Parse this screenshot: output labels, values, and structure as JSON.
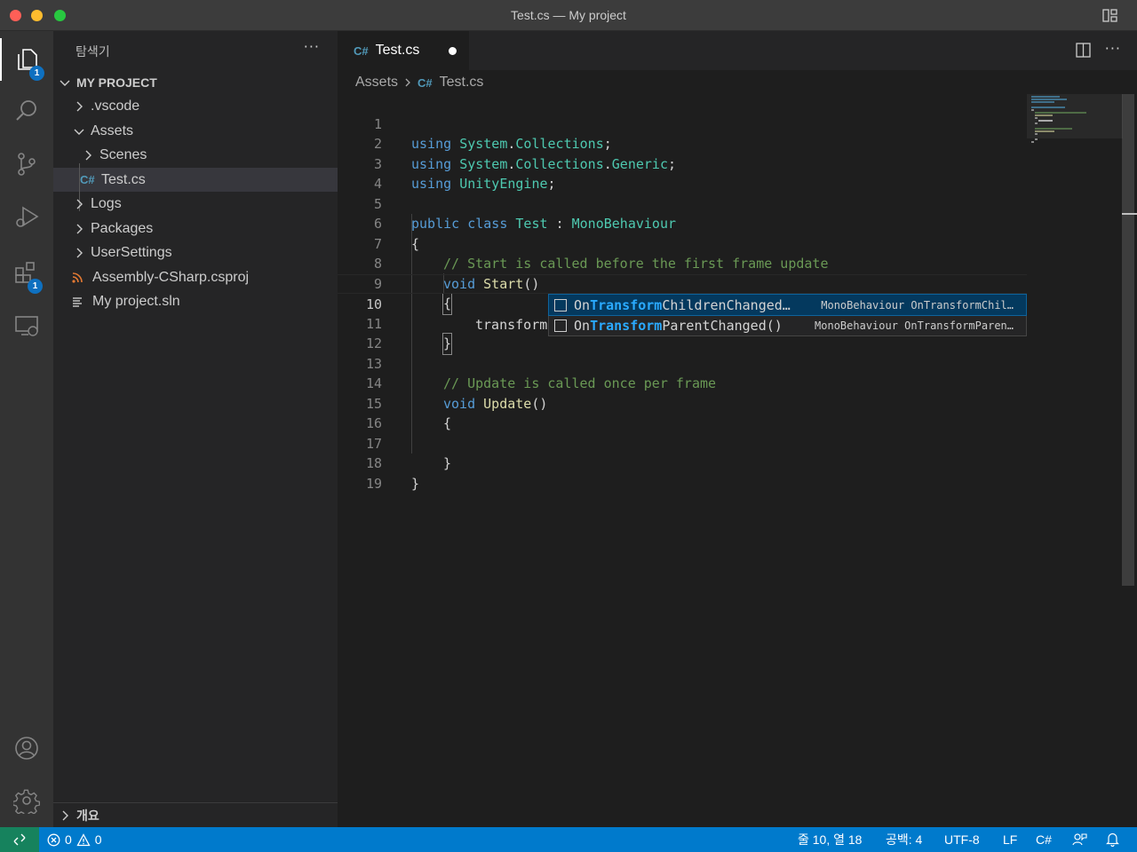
{
  "window": {
    "title": "Test.cs — My project"
  },
  "activity": {
    "explorer_badge": "1",
    "extensions_badge": "1"
  },
  "sidebar": {
    "title": "탐색기",
    "more": "···",
    "project": "MY PROJECT",
    "items": [
      {
        "label": ".vscode"
      },
      {
        "label": "Assets"
      },
      {
        "label": "Scenes"
      },
      {
        "label": "Test.cs",
        "icon": "C#"
      },
      {
        "label": "Logs"
      },
      {
        "label": "Packages"
      },
      {
        "label": "UserSettings"
      },
      {
        "label": "Assembly-CSharp.csproj",
        "icon": "rss-icon"
      },
      {
        "label": "My project.sln",
        "icon": "list-icon"
      }
    ],
    "outline": "개요"
  },
  "editor": {
    "tab": {
      "label": "Test.cs",
      "icon": "C#"
    },
    "more": "···",
    "breadcrumb": {
      "folder": "Assets",
      "file": "Test.cs"
    },
    "line_numbers": [
      "1",
      "2",
      "3",
      "4",
      "5",
      "6",
      "7",
      "8",
      "9",
      "10",
      "11",
      "12",
      "13",
      "14",
      "15",
      "16",
      "17",
      "18",
      "19"
    ],
    "code": {
      "l1": {
        "kw": "using",
        "a": "System",
        "b": "Collections",
        "end": ";"
      },
      "l2": {
        "kw": "using",
        "a": "System",
        "b": "Collections",
        "c": "Generic",
        "end": ";"
      },
      "l3": {
        "kw": "using",
        "a": "UnityEngine",
        "end": ";"
      },
      "l5": {
        "kw1": "public",
        "kw2": "class",
        "name": "Test",
        "colon": ":",
        "base": "MonoBehaviour"
      },
      "l6": "{",
      "l7": "// Start is called before the first frame update",
      "l8": {
        "kw": "void",
        "fn": "Start",
        "paren": "()"
      },
      "l9": "{",
      "l10": "transform",
      "l11": "}",
      "l13": "// Update is called once per frame",
      "l14": {
        "kw": "void",
        "fn": "Update",
        "paren": "()"
      },
      "l15": "{",
      "l17": "}",
      "l18": "}"
    },
    "current_line": 10
  },
  "suggest": [
    {
      "pre": "On",
      "hl": "Transform",
      "post": "ChildrenChanged…",
      "detail": "MonoBehaviour OnTransformChil…"
    },
    {
      "pre": "On",
      "hl": "Transform",
      "post": "ParentChanged()",
      "detail": "MonoBehaviour OnTransformParen…"
    }
  ],
  "status": {
    "errors": "0",
    "warnings": "0",
    "position": "줄 10, 열 18",
    "spaces": "공백: 4",
    "encoding": "UTF-8",
    "eol": "LF",
    "language": "C#"
  },
  "colors": {
    "statusbar": "#007acc",
    "remote": "#16825d",
    "keyword": "#569cd6",
    "type": "#4ec9b0",
    "function": "#dcdcaa",
    "comment": "#6a9955",
    "highlight": "#2aaaff"
  }
}
